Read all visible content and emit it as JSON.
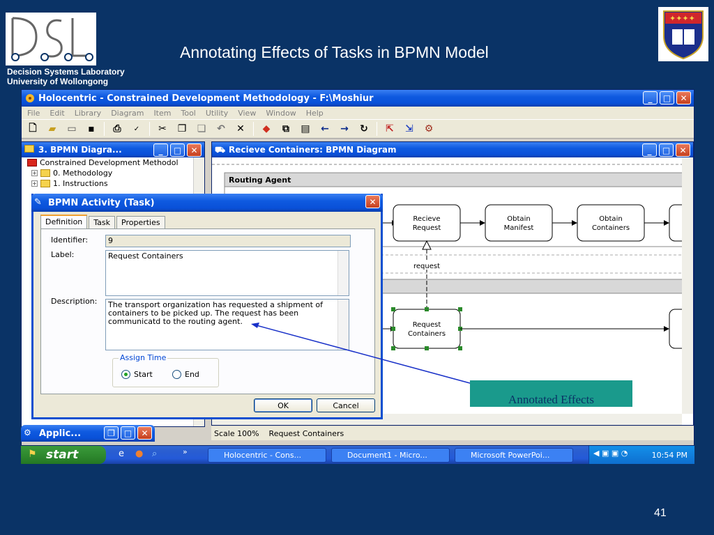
{
  "slide": {
    "title": "Annotating Effects of Tasks in BPMN Model",
    "lab_line1": "Decision Systems Laboratory",
    "lab_line2": "University of Wollongong",
    "logo_text": "DSL",
    "page_number": "41",
    "annotation_label": "Annotated Effects"
  },
  "app": {
    "title": "Holocentric - Constrained Development Methodology - F:\\Moshiur",
    "menu": [
      "File",
      "Edit",
      "Library",
      "Diagram",
      "Item",
      "Tool",
      "Utility",
      "View",
      "Window",
      "Help"
    ]
  },
  "tree_panel": {
    "title": "3. BPMN Diagra...",
    "items": [
      {
        "label": "Constrained Development Methodol",
        "icon": "red-folder-icon"
      },
      {
        "label": "0. Methodology",
        "icon": "folder-icon"
      },
      {
        "label": "1. Instructions",
        "icon": "folder-icon"
      }
    ]
  },
  "diagram": {
    "title": "Recieve Containers: BPMN Diagram",
    "lane1": "Routing Agent",
    "tasks": [
      "Recieve Request",
      "Obtain Manifest",
      "Obtain Containers",
      "Request Containers"
    ],
    "message_label": "request"
  },
  "status": {
    "scale": "Scale 100%",
    "selected": "Request Containers"
  },
  "minimized_window": {
    "title": "Applic..."
  },
  "dialog": {
    "title": "BPMN Activity (Task)",
    "tabs": [
      "Definition",
      "Task",
      "Properties"
    ],
    "identifier_label": "Identifier:",
    "identifier_value": "9",
    "label_label": "Label:",
    "label_value": "Request Containers",
    "description_label": "Description:",
    "description_value": "The transport organization has requested a shipment of containers to be picked up.  The request has been communicatd to the routing agent.",
    "assign_time_label": "Assign Time",
    "radio_start": "Start",
    "radio_end": "End",
    "selected_radio": "Start",
    "ok_label": "OK",
    "cancel_label": "Cancel"
  },
  "taskbar": {
    "start_label": "start",
    "items": [
      "Holocentric - Cons...",
      "Document1 - Micro...",
      "Microsoft PowerPoi..."
    ],
    "clock": "10:54 PM"
  },
  "colors": {
    "slide_bg": "#0a3366",
    "xp_blue": "#0a4fd0",
    "annotation_box": "#1a9a8c"
  }
}
